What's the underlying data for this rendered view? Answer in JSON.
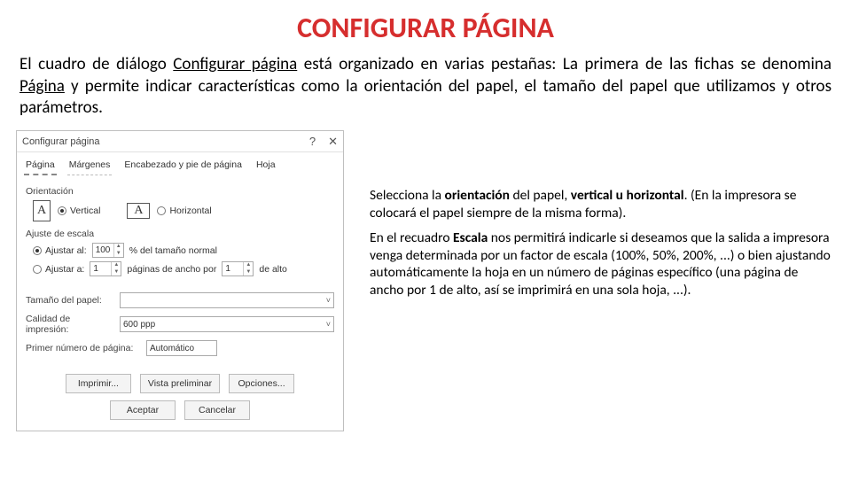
{
  "title": "CONFIGURAR PÁGINA",
  "intro": {
    "p1a": "El cuadro de diálogo ",
    "p1b": "Configurar página",
    "p1c": " está organizado en varias pestañas: La primera de las fichas se denomina ",
    "p1d": "Página",
    "p1e": " y permite indicar características como la orientación del papel, el tamaño del papel que utilizamos y otros parámetros."
  },
  "dialog": {
    "title": "Configurar página",
    "help": "?",
    "close": "✕",
    "tabs": {
      "t1": "Página",
      "t2": "Márgenes",
      "t3": "Encabezado y pie de página",
      "t4": "Hoja"
    },
    "orientation": {
      "label": "Orientación",
      "icon": "A",
      "vertical": "Vertical",
      "horizontal": "Horizontal"
    },
    "scale": {
      "label": "Ajuste de escala",
      "adjust_to": "Ajustar al:",
      "adjust_val": "100",
      "adjust_suffix": "% del tamaño normal",
      "fit_to": "Ajustar a:",
      "fit_w": "1",
      "fit_mid": "páginas de ancho por",
      "fit_h": "1",
      "fit_suffix": "de alto"
    },
    "paper": {
      "label": "Tamaño del papel:",
      "value": ""
    },
    "quality": {
      "label": "Calidad de impresión:",
      "value": "600 ppp"
    },
    "firstpage": {
      "label": "Primer número de página:",
      "value": "Automático"
    },
    "buttons": {
      "print": "Imprimir...",
      "preview": "Vista preliminar",
      "options": "Opciones...",
      "ok": "Aceptar",
      "cancel": "Cancelar"
    }
  },
  "side": {
    "p1a": "Selecciona la ",
    "p1b": "orientación",
    "p1c": " del papel, ",
    "p1d": "vertical u horizontal",
    "p1e": ". (En la impresora se colocará el papel siempre de la misma forma).",
    "p2a": "En el recuadro ",
    "p2b": "Escala",
    "p2c": " nos permitirá indicarle si deseamos que la salida a impresora venga determinada por un factor de escala (100%, 50%, 200%, ...) o bien ajustando automáticamente la hoja en un número de páginas específico (una página de ancho por 1 de alto, así se imprimirá en una sola hoja, ...)."
  }
}
